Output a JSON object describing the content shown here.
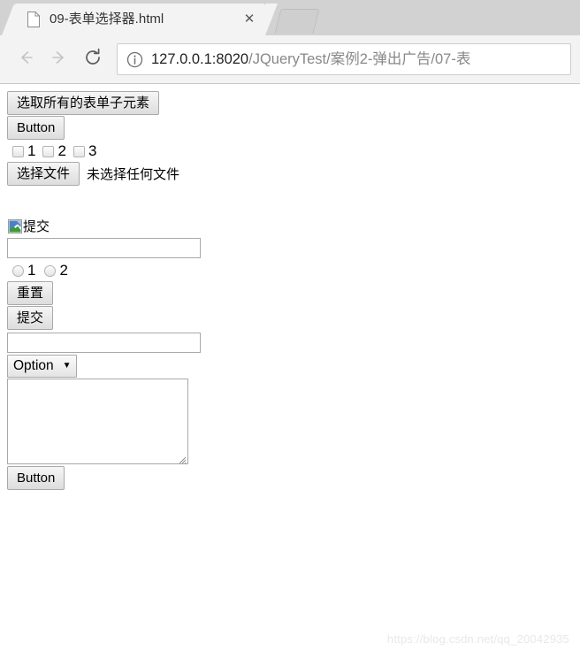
{
  "browser": {
    "tab": {
      "favicon": "page-document-icon",
      "title": "09-表单选择器.html",
      "close_label": "✕"
    },
    "newtab_label": "",
    "toolbar": {
      "back_icon": "arrow-left-icon",
      "forward_icon": "arrow-right-icon",
      "reload_icon": "reload-icon",
      "security_icon": "info-circle-icon",
      "url_host": "127.0.0.1:8020",
      "url_path": "/JQueryTest/案例2-弹出广告/07-表"
    }
  },
  "page": {
    "select_all_button": "选取所有的表单子元素",
    "plain_button": "Button",
    "checkboxes": [
      {
        "label": "1",
        "checked": false
      },
      {
        "label": "2",
        "checked": false
      },
      {
        "label": "3",
        "checked": false
      }
    ],
    "file_input": {
      "button_label": "选择文件",
      "status_text": "未选择任何文件"
    },
    "image_submit": {
      "icon": "broken-image-icon",
      "alt_text": "提交"
    },
    "password_field": {
      "value": "",
      "placeholder": ""
    },
    "radios": [
      {
        "label": "1",
        "checked": false
      },
      {
        "label": "2",
        "checked": false
      }
    ],
    "reset_button": "重置",
    "submit_button": "提交",
    "text_field": {
      "value": "",
      "placeholder": ""
    },
    "select": {
      "selected_option": "Option",
      "caret": "▼"
    },
    "textarea": {
      "value": "",
      "placeholder": ""
    },
    "bottom_button": "Button",
    "watermark": "https://blog.csdn.net/qq_20042935"
  },
  "colors": {
    "chrome_bg": "#d2d2d2",
    "toolbar_bg": "#f3f3f3",
    "tab_bg": "#f3f3f3",
    "page_bg": "#ffffff",
    "control_border": "#a9a9a9",
    "watermark": "#e8e8e8"
  }
}
